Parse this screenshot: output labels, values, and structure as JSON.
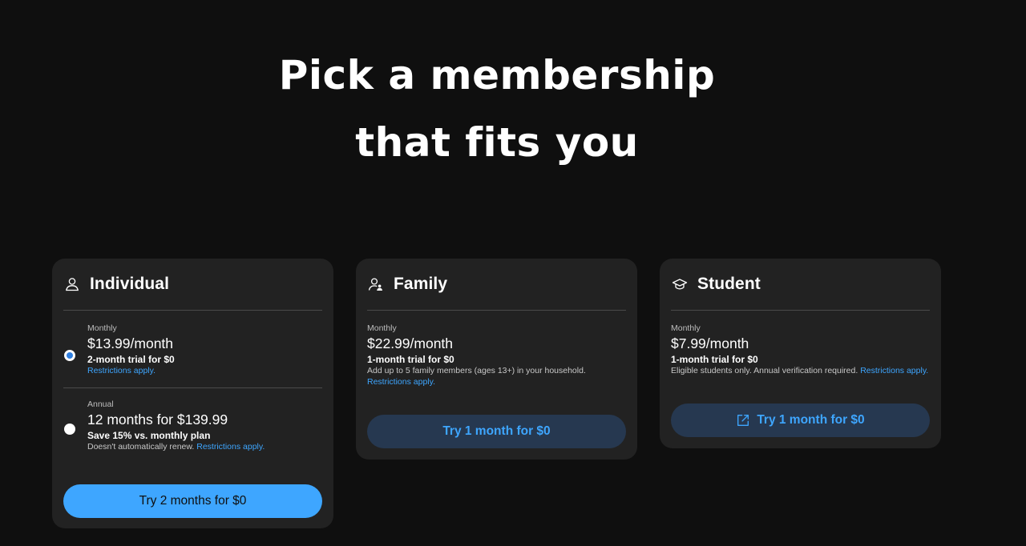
{
  "headline": {
    "line1": "Pick a membership",
    "line2": "that fits you"
  },
  "plans": {
    "individual": {
      "title": "Individual",
      "icon": "person-icon",
      "options": [
        {
          "period": "Monthly",
          "price": "$13.99/month",
          "trial": "2-month trial for $0",
          "note": "",
          "restrictions": "Restrictions apply.",
          "selected": true
        },
        {
          "period": "Annual",
          "price": "12 months for $139.99",
          "trial": "Save 15% vs. monthly plan",
          "note": "Doesn't automatically renew.",
          "restrictions": "Restrictions apply.",
          "selected": false
        }
      ],
      "cta": "Try 2 months for $0"
    },
    "family": {
      "title": "Family",
      "icon": "family-icon",
      "period": "Monthly",
      "price": "$22.99/month",
      "trial": "1-month trial for $0",
      "note": "Add up to 5 family members (ages 13+) in your household.",
      "restrictions": "Restrictions apply.",
      "cta": "Try 1 month for $0"
    },
    "student": {
      "title": "Student",
      "icon": "graduation-cap-icon",
      "period": "Monthly",
      "price": "$7.99/month",
      "trial": "1-month trial for $0",
      "note": "Eligible students only. Annual verification required.",
      "restrictions": "Restrictions apply.",
      "cta": "Try 1 month for $0",
      "cta_icon": "external-link-icon"
    }
  },
  "colors": {
    "background": "#0f0f0f",
    "card": "#222222",
    "accent": "#3ea6ff",
    "secondary_button": "#263850"
  }
}
